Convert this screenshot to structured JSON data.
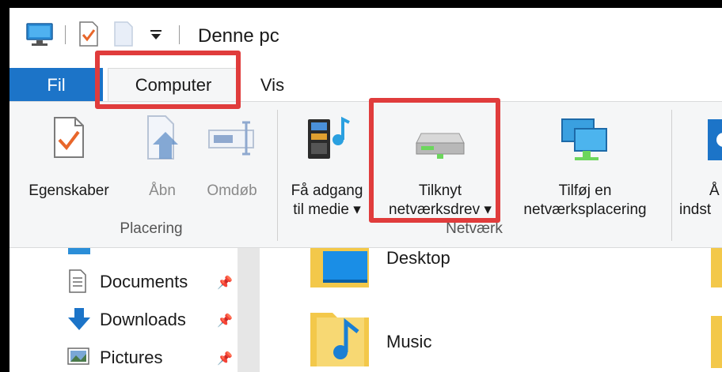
{
  "window": {
    "title": "Denne pc"
  },
  "tabs": {
    "file": "Fil",
    "computer": "Computer",
    "view": "Vis"
  },
  "ribbon": {
    "groups": [
      {
        "label": "Placering",
        "buttons": [
          "Egenskaber",
          "Åbn",
          "Omdøb"
        ]
      },
      {
        "label": "Netværk",
        "buttons": [
          [
            "Få adgang",
            "til medie ▾"
          ],
          [
            "Tilknyt",
            "netværksdrev ▾"
          ],
          [
            "Tilføj en",
            "netværksplacering"
          ]
        ]
      }
    ],
    "partial_button": [
      "Å",
      "indst"
    ]
  },
  "nav": {
    "items": [
      {
        "label": "Documents",
        "icon": "document-icon"
      },
      {
        "label": "Downloads",
        "icon": "download-arrow-icon"
      },
      {
        "label": "Pictures",
        "icon": "pictures-icon"
      }
    ]
  },
  "content": {
    "items": [
      "Desktop",
      "Music"
    ]
  },
  "colors": {
    "accent": "#1c74c8",
    "highlight": "#e03c3c",
    "ribbon_bg": "#f5f6f7"
  }
}
